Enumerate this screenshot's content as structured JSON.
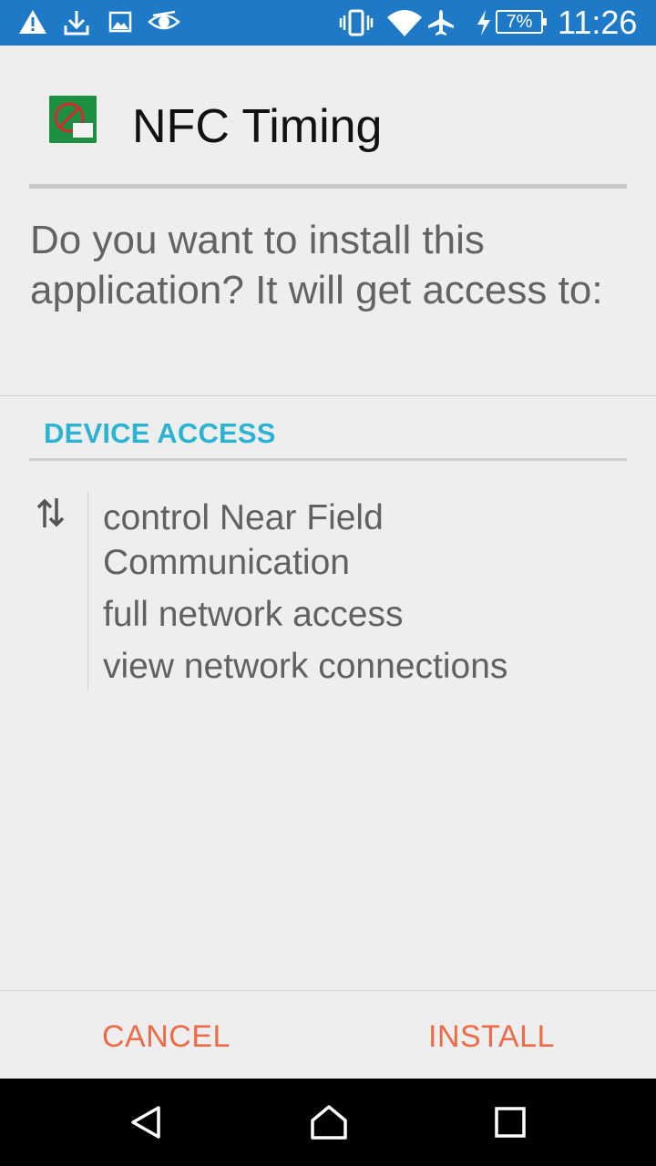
{
  "status_bar": {
    "icons": [
      "warning-icon",
      "download-icon",
      "image-icon",
      "eye-icon",
      "vibrate-icon",
      "wifi-icon",
      "airplane-icon",
      "charging-icon"
    ],
    "battery_percent": "7%",
    "time": "11:26",
    "color": "#1e7ac7"
  },
  "header": {
    "app_name": "NFC Timing",
    "app_icon": "nfc-timing-app-icon"
  },
  "prompt": "Do you want to install this application? It will get access to:",
  "section": {
    "title": "DEVICE ACCESS",
    "icon": "transfer-arrows-icon",
    "color": "#2bb3d3"
  },
  "permissions": [
    "control Near Field Communication",
    "full network access",
    "view network connections"
  ],
  "buttons": {
    "cancel": "CANCEL",
    "install": "INSTALL",
    "color": "#ee6b47"
  },
  "nav_bar": {
    "icons": [
      "back-icon",
      "home-icon",
      "recents-icon"
    ]
  }
}
